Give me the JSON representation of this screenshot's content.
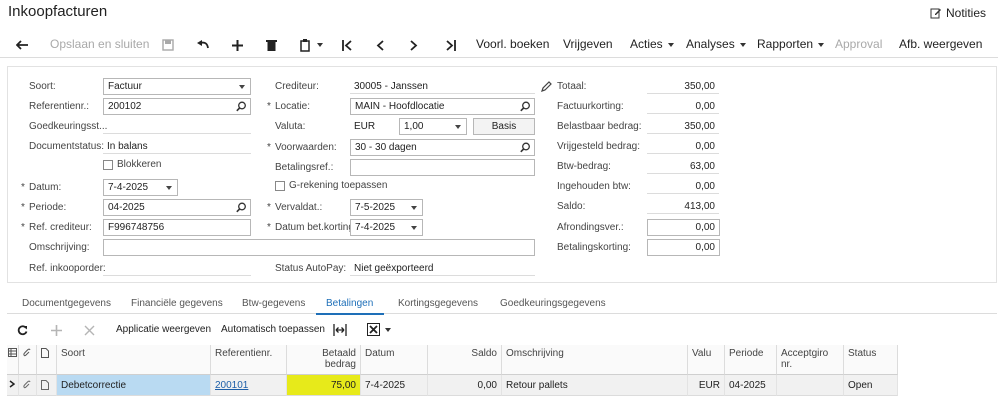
{
  "page": {
    "title": "Inkoopfacturen",
    "notes_label": "Notities"
  },
  "toolbar": {
    "save_close": "Opslaan en sluiten",
    "preview": "Voorl. boeken",
    "release": "Vrijgeven",
    "actions": "Acties",
    "analyses": "Analyses",
    "reports": "Rapporten",
    "approval": "Approval",
    "print": "Afb. weergeven"
  },
  "form": {
    "col1": {
      "type_label": "Soort:",
      "type_value": "Factuur",
      "ref_label": "Referentienr.:",
      "ref_value": "200102",
      "approval_label": "Goedkeuringsst...",
      "docstatus_label": "Documentstatus:",
      "docstatus_value": "In balans",
      "hold_label": "Blokkeren",
      "date_label": "Datum:",
      "date_value": "7-4-2025",
      "period_label": "Periode:",
      "period_value": "04-2025",
      "vendor_ref_label": "Ref. crediteur:",
      "vendor_ref_value": "F996748756",
      "desc_label": "Omschrijving:",
      "desc_value": "",
      "po_label": "Ref. inkooporder:"
    },
    "col2": {
      "vendor_label": "Crediteur:",
      "vendor_value": "30005 - Janssen",
      "location_label": "Locatie:",
      "location_value": "MAIN - Hoofdlocatie",
      "currency_label": "Valuta:",
      "currency_value": "EUR",
      "rate_value": "1,00",
      "basis_label": "Basis",
      "terms_label": "Voorwaarden:",
      "terms_value": "30 - 30 dagen",
      "payref_label": "Betalingsref.:",
      "payref_value": "",
      "grek_label": "G-rekening toepassen",
      "due_label": "Vervaldat.:",
      "due_value": "7-5-2025",
      "cashdisc_label": "Datum bet.korting:",
      "cashdisc_value": "7-4-2025",
      "autopay_label": "Status AutoPay:",
      "autopay_value": "Niet geëxporteerd"
    },
    "col3": {
      "total_label": "Totaal:",
      "total_value": "350,00",
      "invdisc_label": "Factuurkorting:",
      "invdisc_value": "0,00",
      "taxable_label": "Belastbaar bedrag:",
      "taxable_value": "350,00",
      "exempt_label": "Vrijgesteld bedrag:",
      "exempt_value": "0,00",
      "vat_label": "Btw-bedrag:",
      "vat_value": "63,00",
      "withheld_label": "Ingehouden btw:",
      "withheld_value": "0,00",
      "balance_label": "Saldo:",
      "balance_value": "413,00",
      "rounding_label": "Afrondingsver.:",
      "rounding_value": "0,00",
      "paydisc_label": "Betalingskorting:",
      "paydisc_value": "0,00"
    }
  },
  "tabs": [
    "Documentgegevens",
    "Financiële gegevens",
    "Btw-gegevens",
    "Betalingen",
    "Kortingsgegevens",
    "Goedkeuringsgegevens"
  ],
  "grid_toolbar": {
    "apply_show": "Applicatie weergeven",
    "auto_apply": "Automatisch toepassen"
  },
  "grid": {
    "headers": {
      "soort": "Soort",
      "ref": "Referentienr.",
      "amount_1": "Betaald",
      "amount_2": "bedrag",
      "date": "Datum",
      "balance": "Saldo",
      "desc": "Omschrijving",
      "cur": "Valu",
      "period": "Periode",
      "acc_1": "Acceptgiro",
      "acc_2": "nr.",
      "status": "Status"
    },
    "row": {
      "soort": "Debetcorrectie",
      "ref": "200101",
      "amount": "75,00",
      "date": "7-4-2025",
      "balance": "0,00",
      "desc": "Retour pallets",
      "cur": "EUR",
      "period": "04-2025",
      "acc": "",
      "status": "Open"
    }
  }
}
